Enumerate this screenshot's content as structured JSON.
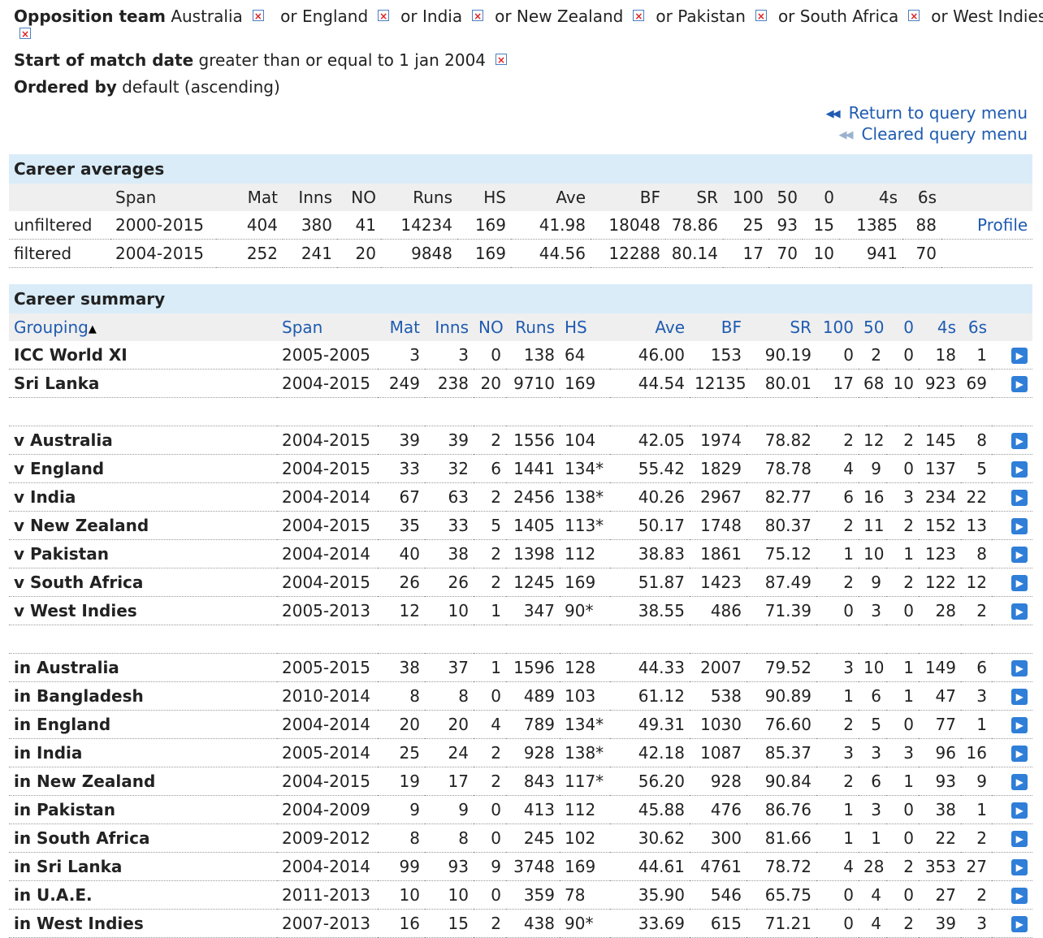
{
  "query": {
    "opposition_label": "Opposition team",
    "opposition_first": "Australia",
    "opposition_rest": [
      "England",
      "India",
      "New Zealand",
      "Pakistan",
      "South Africa",
      "West Indies"
    ],
    "or_word": "or",
    "date_label": "Start of match date",
    "date_value": "greater than or equal to 1 jan 2004",
    "order_label": "Ordered by",
    "order_value": "default (ascending)"
  },
  "links": {
    "return": "Return to query menu",
    "cleared": "Cleared query menu"
  },
  "averages": {
    "title": "Career averages",
    "headers": [
      "",
      "Span",
      "Mat",
      "Inns",
      "NO",
      "Runs",
      "HS",
      "Ave",
      "BF",
      "SR",
      "100",
      "50",
      "0",
      "4s",
      "6s",
      ""
    ],
    "rows": [
      [
        "unfiltered",
        "2000-2015",
        "404",
        "380",
        "41",
        "14234",
        "169",
        "41.98",
        "18048",
        "78.86",
        "25",
        "93",
        "15",
        "1385",
        "88",
        "Profile"
      ],
      [
        "filtered",
        "2004-2015",
        "252",
        "241",
        "20",
        "9848",
        "169",
        "44.56",
        "12288",
        "80.14",
        "17",
        "70",
        "10",
        "941",
        "70",
        ""
      ]
    ]
  },
  "summary": {
    "title": "Career summary",
    "headers": [
      "Grouping",
      "Span",
      "Mat",
      "Inns",
      "NO",
      "Runs",
      "HS",
      "Ave",
      "BF",
      "SR",
      "100",
      "50",
      "0",
      "4s",
      "6s",
      ""
    ],
    "groups": [
      [
        [
          "ICC World XI",
          "2005-2005",
          "3",
          "3",
          "0",
          "138",
          "64",
          "46.00",
          "153",
          "90.19",
          "0",
          "2",
          "0",
          "18",
          "1"
        ],
        [
          "Sri Lanka",
          "2004-2015",
          "249",
          "238",
          "20",
          "9710",
          "169",
          "44.54",
          "12135",
          "80.01",
          "17",
          "68",
          "10",
          "923",
          "69"
        ]
      ],
      [
        [
          "v Australia",
          "2004-2015",
          "39",
          "39",
          "2",
          "1556",
          "104",
          "42.05",
          "1974",
          "78.82",
          "2",
          "12",
          "2",
          "145",
          "8"
        ],
        [
          "v England",
          "2004-2015",
          "33",
          "32",
          "6",
          "1441",
          "134*",
          "55.42",
          "1829",
          "78.78",
          "4",
          "9",
          "0",
          "137",
          "5"
        ],
        [
          "v India",
          "2004-2014",
          "67",
          "63",
          "2",
          "2456",
          "138*",
          "40.26",
          "2967",
          "82.77",
          "6",
          "16",
          "3",
          "234",
          "22"
        ],
        [
          "v New Zealand",
          "2004-2015",
          "35",
          "33",
          "5",
          "1405",
          "113*",
          "50.17",
          "1748",
          "80.37",
          "2",
          "11",
          "2",
          "152",
          "13"
        ],
        [
          "v Pakistan",
          "2004-2014",
          "40",
          "38",
          "2",
          "1398",
          "112",
          "38.83",
          "1861",
          "75.12",
          "1",
          "10",
          "1",
          "123",
          "8"
        ],
        [
          "v South Africa",
          "2004-2015",
          "26",
          "26",
          "2",
          "1245",
          "169",
          "51.87",
          "1423",
          "87.49",
          "2",
          "9",
          "2",
          "122",
          "12"
        ],
        [
          "v West Indies",
          "2005-2013",
          "12",
          "10",
          "1",
          "347",
          "90*",
          "38.55",
          "486",
          "71.39",
          "0",
          "3",
          "0",
          "28",
          "2"
        ]
      ],
      [
        [
          "in Australia",
          "2005-2015",
          "38",
          "37",
          "1",
          "1596",
          "128",
          "44.33",
          "2007",
          "79.52",
          "3",
          "10",
          "1",
          "149",
          "6"
        ],
        [
          "in Bangladesh",
          "2010-2014",
          "8",
          "8",
          "0",
          "489",
          "103",
          "61.12",
          "538",
          "90.89",
          "1",
          "6",
          "1",
          "47",
          "3"
        ],
        [
          "in England",
          "2004-2014",
          "20",
          "20",
          "4",
          "789",
          "134*",
          "49.31",
          "1030",
          "76.60",
          "2",
          "5",
          "0",
          "77",
          "1"
        ],
        [
          "in India",
          "2005-2014",
          "25",
          "24",
          "2",
          "928",
          "138*",
          "42.18",
          "1087",
          "85.37",
          "3",
          "3",
          "3",
          "96",
          "16"
        ],
        [
          "in New Zealand",
          "2004-2015",
          "19",
          "17",
          "2",
          "843",
          "117*",
          "56.20",
          "928",
          "90.84",
          "2",
          "6",
          "1",
          "93",
          "9"
        ],
        [
          "in Pakistan",
          "2004-2009",
          "9",
          "9",
          "0",
          "413",
          "112",
          "45.88",
          "476",
          "86.76",
          "1",
          "3",
          "0",
          "38",
          "1"
        ],
        [
          "in South Africa",
          "2009-2012",
          "8",
          "8",
          "0",
          "245",
          "102",
          "30.62",
          "300",
          "81.66",
          "1",
          "1",
          "0",
          "22",
          "2"
        ],
        [
          "in Sri Lanka",
          "2004-2014",
          "99",
          "93",
          "9",
          "3748",
          "169",
          "44.61",
          "4761",
          "78.72",
          "4",
          "28",
          "2",
          "353",
          "27"
        ],
        [
          "in U.A.E.",
          "2011-2013",
          "10",
          "10",
          "0",
          "359",
          "78",
          "35.90",
          "546",
          "65.75",
          "0",
          "4",
          "0",
          "27",
          "2"
        ],
        [
          "in West Indies",
          "2007-2013",
          "16",
          "15",
          "2",
          "438",
          "90*",
          "33.69",
          "615",
          "71.21",
          "0",
          "4",
          "2",
          "39",
          "3"
        ]
      ]
    ]
  },
  "icons": {
    "remove": "remove-filter-icon",
    "rewind": "rewind-icon",
    "sort": "sort-ascending-icon",
    "arrow": "play-arrow-icon"
  },
  "colors": {
    "link": "#1f5bb0",
    "caption_bg": "#d9ecf8",
    "header_bg": "#efefef",
    "remove_x": "#e02020"
  }
}
